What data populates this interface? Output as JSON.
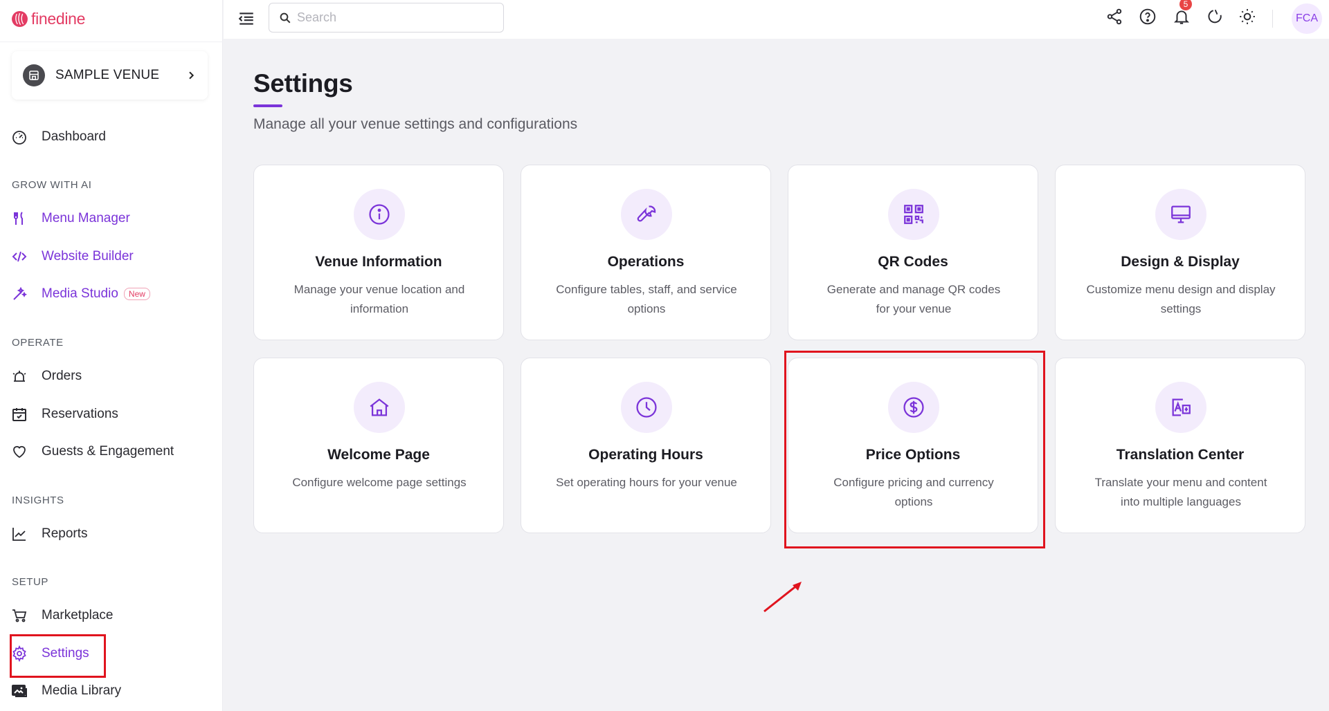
{
  "brand": {
    "name": "finedine",
    "color": "#e33b63",
    "accent": "#7b34d9"
  },
  "venue": {
    "name": "SAMPLE VENUE"
  },
  "sidebar": {
    "dashboard": {
      "label": "Dashboard",
      "icon": "gauge-icon"
    },
    "sections": {
      "grow": "GROW WITH AI",
      "operate": "OPERATE",
      "insights": "INSIGHTS",
      "setup": "SETUP"
    },
    "grow_items": [
      {
        "label": "Menu Manager",
        "icon": "fork-knife-icon"
      },
      {
        "label": "Website Builder",
        "icon": "code-icon"
      },
      {
        "label": "Media Studio",
        "icon": "magic-wand-icon",
        "badge": "New"
      }
    ],
    "operate_items": [
      {
        "label": "Orders",
        "icon": "bell-icon"
      },
      {
        "label": "Reservations",
        "icon": "calendar-check-icon"
      },
      {
        "label": "Guests & Engagement",
        "icon": "heart-icon"
      }
    ],
    "insights_items": [
      {
        "label": "Reports",
        "icon": "line-chart-icon"
      }
    ],
    "setup_items": [
      {
        "label": "Marketplace",
        "icon": "cart-icon"
      },
      {
        "label": "Settings",
        "icon": "gear-icon",
        "active": true
      },
      {
        "label": "Media Library",
        "icon": "images-icon"
      }
    ]
  },
  "topbar": {
    "search_placeholder": "Search",
    "notification_count": "5",
    "avatar_initials": "FCA"
  },
  "main": {
    "title": "Settings",
    "subtitle": "Manage all your venue settings and configurations",
    "cards": [
      {
        "title": "Venue Information",
        "desc": "Manage your venue location and information",
        "icon": "info-icon"
      },
      {
        "title": "Operations",
        "desc": "Configure tables, staff, and service options",
        "icon": "wrench-icon"
      },
      {
        "title": "QR Codes",
        "desc": "Generate and manage QR codes for your venue",
        "icon": "qr-code-icon"
      },
      {
        "title": "Design & Display",
        "desc": "Customize menu design and display settings",
        "icon": "monitor-icon"
      },
      {
        "title": "Welcome Page",
        "desc": "Configure welcome page settings",
        "icon": "home-icon"
      },
      {
        "title": "Operating Hours",
        "desc": "Set operating hours for your venue",
        "icon": "clock-icon"
      },
      {
        "title": "Price Options",
        "desc": "Configure pricing and currency options",
        "icon": "dollar-icon",
        "highlighted": true
      },
      {
        "title": "Translation Center",
        "desc": "Translate your menu and content into multiple languages",
        "icon": "translate-icon"
      }
    ]
  },
  "annotation_color": "#e0141e"
}
